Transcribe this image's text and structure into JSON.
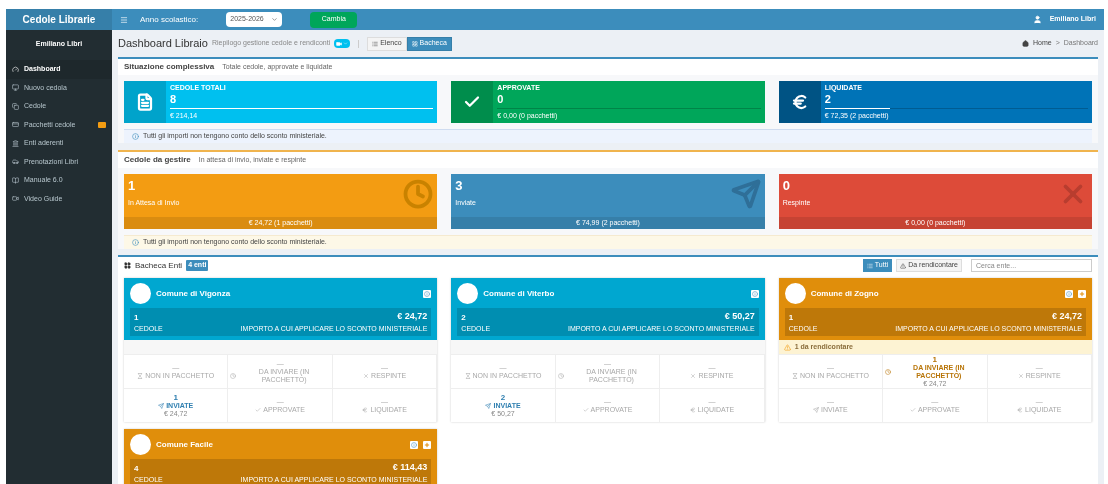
{
  "topbar": {
    "brand": "Cedole Librarie",
    "year_label": "Anno scolastico:",
    "year_value": "2025-2026",
    "button": "Cambia",
    "user": "Emiliano Libri"
  },
  "sidebar": {
    "user": "Emiliano Libri",
    "items": [
      {
        "kind": "dashboard",
        "label": "Dashboard",
        "selected": true
      },
      {
        "kind": "new",
        "label": "Nuovo cedola",
        "selected": false
      },
      {
        "kind": "cedole",
        "label": "Cedole",
        "selected": false
      },
      {
        "kind": "packages",
        "label": "Pacchetti cedole",
        "selected": false,
        "badge": true
      },
      {
        "kind": "enti",
        "label": "Enti aderenti",
        "selected": false
      },
      {
        "kind": "bookings",
        "label": "Prenotazioni Libri",
        "selected": false
      },
      {
        "kind": "manual",
        "label": "Manuale 6.0",
        "selected": false
      },
      {
        "kind": "video",
        "label": "Video Guide",
        "selected": false
      }
    ]
  },
  "header": {
    "title": "Dashboard Libraio",
    "subtitle": "Riepilogo gestione cedole e rendiconti",
    "views": [
      {
        "kind": "list",
        "label": "Elenco",
        "selected": false
      },
      {
        "kind": "grid",
        "label": "Bacheca",
        "selected": true
      }
    ],
    "breadcrumb": [
      "Home",
      "Dashboard"
    ],
    "breadcrumb_separator": ">"
  },
  "summary": {
    "title": "Situazione complessiva",
    "subtitle": "Totale cedole, approvate e liquidate",
    "tiles": [
      {
        "kind": "total",
        "label": "CEDOLE TOTALI",
        "value": "8",
        "level": 1,
        "amount": "€ 214,14"
      },
      {
        "kind": "approved",
        "label": "APPROVATE",
        "value": "0",
        "level": 0,
        "amount": "€ 0,00 (0 pacchetti)"
      },
      {
        "kind": "paid",
        "label": "LIQUIDATE",
        "value": "2",
        "level": 0.25,
        "amount": "€ 72,35 (2 pacchetti)"
      }
    ],
    "note": "Tutti gli importi non tengono conto dello sconto ministeriale."
  },
  "manage": {
    "title": "Cedole da gestire",
    "subtitle": "In attesa di invio, inviate e respinte",
    "tiles": [
      {
        "kind": "waiting",
        "value": "1",
        "label": "In Attesa di Invio",
        "amount": "€ 24,72",
        "packages": "(1 pacchetti)"
      },
      {
        "kind": "sent",
        "value": "3",
        "label": "Inviate",
        "amount": "€ 74,99",
        "packages": "(2 pacchetti)"
      },
      {
        "kind": "rejected",
        "value": "0",
        "label": "Respinte",
        "amount": "€ 0,00",
        "packages": "(0 pacchetti)"
      }
    ],
    "note": "Tutti gli importi non tengono conto dello sconto ministeriale."
  },
  "board": {
    "title": "Bacheca Enti",
    "count": "4 enti",
    "filters": [
      {
        "kind": "all",
        "label": "Tutti",
        "selected": true
      },
      {
        "kind": "todo",
        "label": "Da rendicontare",
        "selected": false
      }
    ],
    "search_placeholder": "Cerca ente...",
    "enti": [
      {
        "name": "Comune di Vigonza",
        "color": "#00a7d0",
        "count": "1",
        "count_label": "CEDOLE",
        "total": "€ 24,72",
        "total_label": "IMPORTO A CUI APPLICARE LO SCONTO MINISTERIALE",
        "plus": false,
        "stats": [
          {
            "kind": "notpacked",
            "value": "—",
            "label": "NON IN PACCHETTO",
            "active": false
          },
          {
            "kind": "tosend",
            "value": "—",
            "label": "DA INVIARE (IN PACCHETTO)",
            "active": false
          },
          {
            "kind": "rejected",
            "value": "—",
            "label": "RESPINTE",
            "active": false
          },
          {
            "kind": "sent",
            "value": "1",
            "label": "INVIATE",
            "amount": "€ 24,72",
            "active": true
          },
          {
            "kind": "approved",
            "value": "—",
            "label": "APPROVATE",
            "active": false
          },
          {
            "kind": "paid",
            "value": "—",
            "label": "LIQUIDATE",
            "active": false
          }
        ]
      },
      {
        "name": "Comune di Viterbo",
        "color": "#00a7d0",
        "count": "2",
        "count_label": "CEDOLE",
        "total": "€ 50,27",
        "total_label": "IMPORTO A CUI APPLICARE LO SCONTO MINISTERIALE",
        "plus": false,
        "stats": [
          {
            "kind": "notpacked",
            "value": "—",
            "label": "NON IN PACCHETTO",
            "active": false
          },
          {
            "kind": "tosend",
            "value": "—",
            "label": "DA INVIARE (IN PACCHETTO)",
            "active": false
          },
          {
            "kind": "rejected",
            "value": "—",
            "label": "RESPINTE",
            "active": false
          },
          {
            "kind": "sent",
            "value": "2",
            "label": "INVIATE",
            "amount": "€ 50,27",
            "active": true
          },
          {
            "kind": "approved",
            "value": "—",
            "label": "APPROVATE",
            "active": false
          },
          {
            "kind": "paid",
            "value": "—",
            "label": "LIQUIDATE",
            "active": false
          }
        ]
      },
      {
        "name": "Comune di Zogno",
        "color": "#e08e0b",
        "count": "1",
        "count_label": "CEDOLE",
        "total": "€ 24,72",
        "total_label": "IMPORTO A CUI APPLICARE LO SCONTO MINISTERIALE",
        "plus": true,
        "warning": "1 da rendicontare",
        "stats": [
          {
            "kind": "notpacked",
            "value": "—",
            "label": "NON IN PACCHETTO",
            "active": false
          },
          {
            "kind": "tosend",
            "value": "1",
            "label": "DA INVIARE (IN PACCHETTO)",
            "amount": "€ 24,72",
            "active": true
          },
          {
            "kind": "rejected",
            "value": "—",
            "label": "RESPINTE",
            "active": false
          },
          {
            "kind": "sent",
            "value": "—",
            "label": "INVIATE",
            "active": false
          },
          {
            "kind": "approved",
            "value": "—",
            "label": "APPROVATE",
            "active": false
          },
          {
            "kind": "paid",
            "value": "—",
            "label": "LIQUIDATE",
            "active": false
          }
        ]
      },
      {
        "name": "Comune Facile",
        "color": "#e08e0b",
        "count": "4",
        "count_label": "CEDOLE",
        "total": "€ 114,43",
        "total_label": "IMPORTO A CUI APPLICARE LO SCONTO MINISTERIALE",
        "plus": true
      }
    ]
  }
}
